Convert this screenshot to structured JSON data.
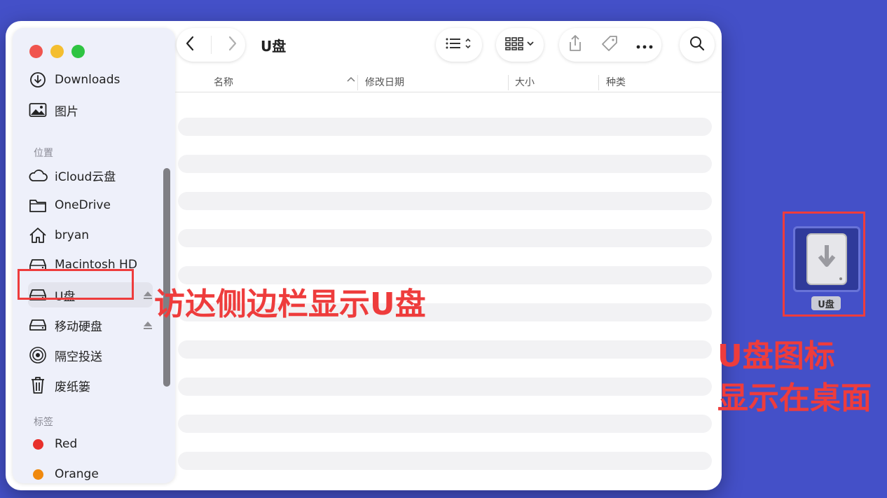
{
  "window": {
    "title": "U盘"
  },
  "sidebar": {
    "items_top": [
      {
        "label": "Downloads",
        "icon": "download-circle-icon"
      },
      {
        "label": "图片",
        "icon": "photo-icon"
      }
    ],
    "locations_header": "位置",
    "locations": [
      {
        "label": "iCloud云盘",
        "icon": "cloud-icon"
      },
      {
        "label": "OneDrive",
        "icon": "folder-icon"
      },
      {
        "label": "bryan",
        "icon": "home-icon"
      },
      {
        "label": "Macintosh HD",
        "icon": "disk-icon"
      },
      {
        "label": "U盘",
        "icon": "disk-icon",
        "eject": true
      },
      {
        "label": "移动硬盘",
        "icon": "disk-icon",
        "eject": true
      },
      {
        "label": "隔空投送",
        "icon": "airdrop-icon"
      },
      {
        "label": "废纸篓",
        "icon": "trash-icon"
      }
    ],
    "tags_header": "标签",
    "tags": [
      {
        "label": "Red",
        "color": "#e8302c"
      },
      {
        "label": "Orange",
        "color": "#f0890e"
      }
    ]
  },
  "toolbar": {
    "back_icon": "chevron-left-icon",
    "forward_icon": "chevron-right-icon",
    "view_icon": "list-view-icon",
    "group_icon": "grid-view-icon",
    "share_icon": "share-icon",
    "tag_icon": "tag-icon",
    "more_icon": "ellipsis-icon",
    "search_icon": "search-icon"
  },
  "columns": {
    "name": "名称",
    "modified": "修改日期",
    "size": "大小",
    "kind": "种类"
  },
  "desktop": {
    "drive_label": "U盘"
  },
  "annotations": {
    "sidebar_note": "访达侧边栏显示U盘",
    "desktop_note_line1": "U盘图标",
    "desktop_note_line2": "显示在桌面"
  },
  "colors": {
    "annotation": "#ee3c3c",
    "desktop": "#4450c8"
  }
}
